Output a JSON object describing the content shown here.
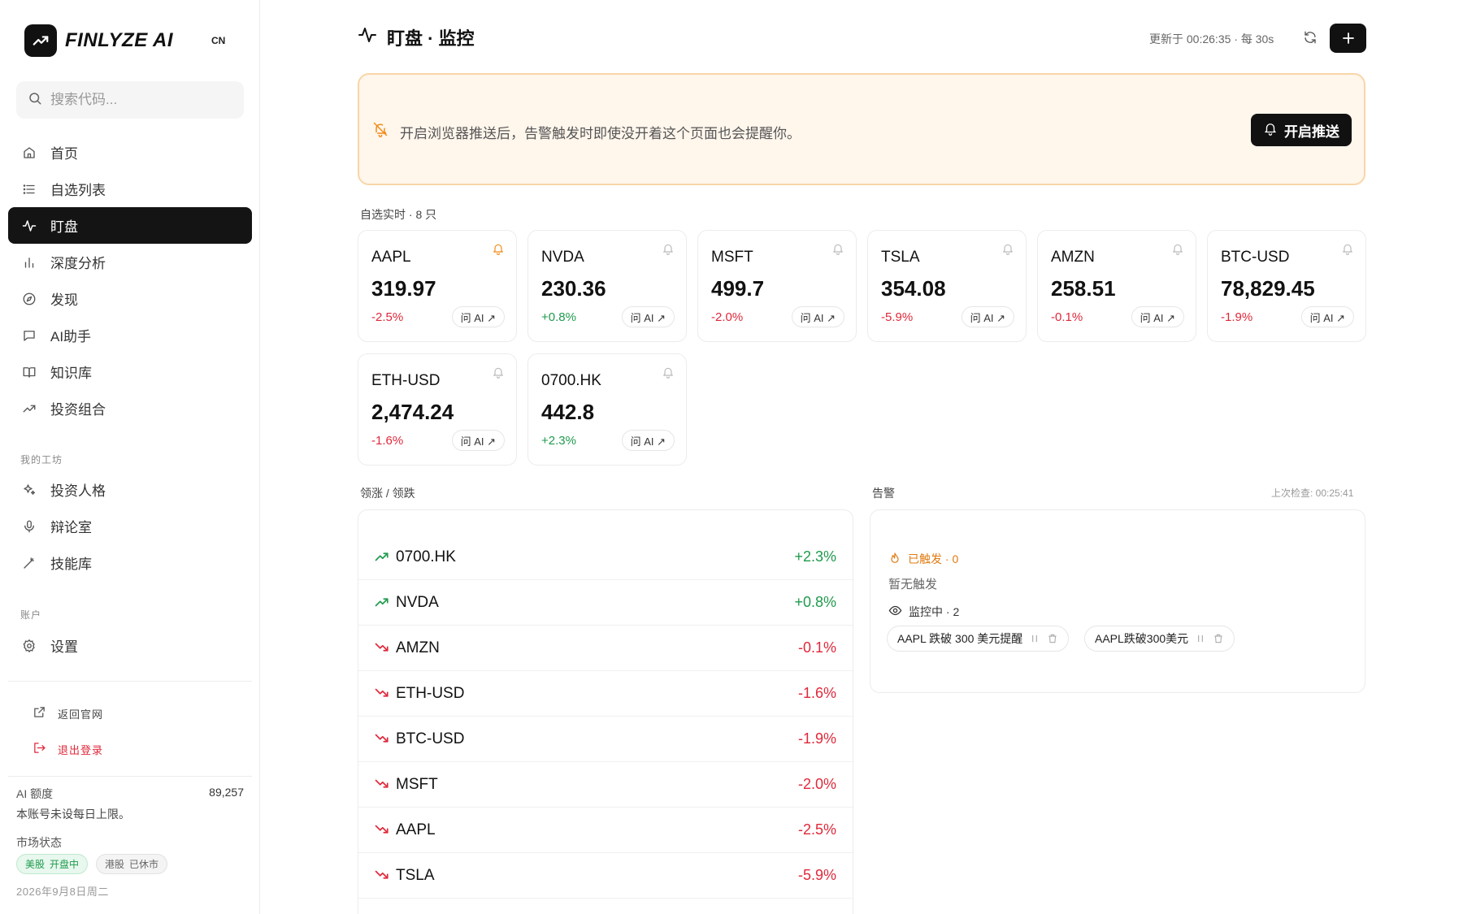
{
  "brand": {
    "name": "FINLYZE AI",
    "lang": "CN"
  },
  "search": {
    "placeholder": "搜索代码..."
  },
  "nav": [
    {
      "label": "首页",
      "icon": "home-icon"
    },
    {
      "label": "自选列表",
      "icon": "list-icon"
    },
    {
      "label": "盯盘",
      "icon": "pulse-icon",
      "active": true
    },
    {
      "label": "深度分析",
      "icon": "bar-chart-icon"
    },
    {
      "label": "发现",
      "icon": "compass-icon"
    },
    {
      "label": "AI助手",
      "icon": "chat-icon"
    },
    {
      "label": "知识库",
      "icon": "book-icon"
    },
    {
      "label": "投资组合",
      "icon": "trending-up-icon"
    }
  ],
  "workshop": {
    "title": "我的工坊",
    "items": [
      {
        "label": "投资人格",
        "icon": "sparkles-icon"
      },
      {
        "label": "辩论室",
        "icon": "mic-icon"
      },
      {
        "label": "技能库",
        "icon": "wand-icon"
      }
    ]
  },
  "account": {
    "title": "账户",
    "items": [
      {
        "label": "设置",
        "icon": "gear-icon"
      }
    ]
  },
  "footer": {
    "back_site": "返回官网",
    "logout": "退出登录",
    "quota_label": "AI 额度",
    "quota_value": "89,257",
    "quota_note": "本账号未设每日上限。",
    "market_label": "市场状态",
    "us_market": "美股",
    "us_status": "开盘中",
    "hk_market": "港股",
    "hk_status": "已休市",
    "date": "2026年9月8日周二"
  },
  "header": {
    "title": "盯盘 · 监控",
    "updated": "更新于 00:26:35 · 每 30s"
  },
  "banner": {
    "text": "开启浏览器推送后，告警触发时即使没开着这个页面也会提醒你。",
    "button": "开启推送"
  },
  "watch": {
    "title": "自选实时 · 8 只",
    "ask_label": "问 AI ↗",
    "items": [
      {
        "symbol": "AAPL",
        "price": "319.97",
        "change": "-2.5%",
        "dir": "down",
        "alert": true
      },
      {
        "symbol": "NVDA",
        "price": "230.36",
        "change": "+0.8%",
        "dir": "up",
        "alert": false
      },
      {
        "symbol": "MSFT",
        "price": "499.7",
        "change": "-2.0%",
        "dir": "down",
        "alert": false
      },
      {
        "symbol": "TSLA",
        "price": "354.08",
        "change": "-5.9%",
        "dir": "down",
        "alert": false
      },
      {
        "symbol": "AMZN",
        "price": "258.51",
        "change": "-0.1%",
        "dir": "down",
        "alert": false
      },
      {
        "symbol": "BTC-USD",
        "price": "78,829.45",
        "change": "-1.9%",
        "dir": "down",
        "alert": false
      },
      {
        "symbol": "ETH-USD",
        "price": "2,474.24",
        "change": "-1.6%",
        "dir": "down",
        "alert": false
      },
      {
        "symbol": "0700.HK",
        "price": "442.8",
        "change": "+2.3%",
        "dir": "up",
        "alert": false
      }
    ]
  },
  "movers": {
    "title": "领涨 / 领跌",
    "rows": [
      {
        "symbol": "0700.HK",
        "change": "+2.3%",
        "dir": "up"
      },
      {
        "symbol": "NVDA",
        "change": "+0.8%",
        "dir": "up"
      },
      {
        "symbol": "AMZN",
        "change": "-0.1%",
        "dir": "down"
      },
      {
        "symbol": "ETH-USD",
        "change": "-1.6%",
        "dir": "down"
      },
      {
        "symbol": "BTC-USD",
        "change": "-1.9%",
        "dir": "down"
      },
      {
        "symbol": "MSFT",
        "change": "-2.0%",
        "dir": "down"
      },
      {
        "symbol": "AAPL",
        "change": "-2.5%",
        "dir": "down"
      },
      {
        "symbol": "TSLA",
        "change": "-5.9%",
        "dir": "down"
      }
    ]
  },
  "alerts": {
    "title": "告警",
    "last_check": "上次检查: 00:25:41",
    "triggered": "已触发 · 0",
    "none": "暂无触发",
    "monitoring": "监控中 · 2",
    "chips": [
      "AAPL 跌破 300 美元提醒",
      "AAPL跌破300美元"
    ]
  },
  "colors": {
    "up": "#1f9a4d",
    "down": "#e0283a",
    "accent": "#f08c1a",
    "dark": "#111111"
  }
}
